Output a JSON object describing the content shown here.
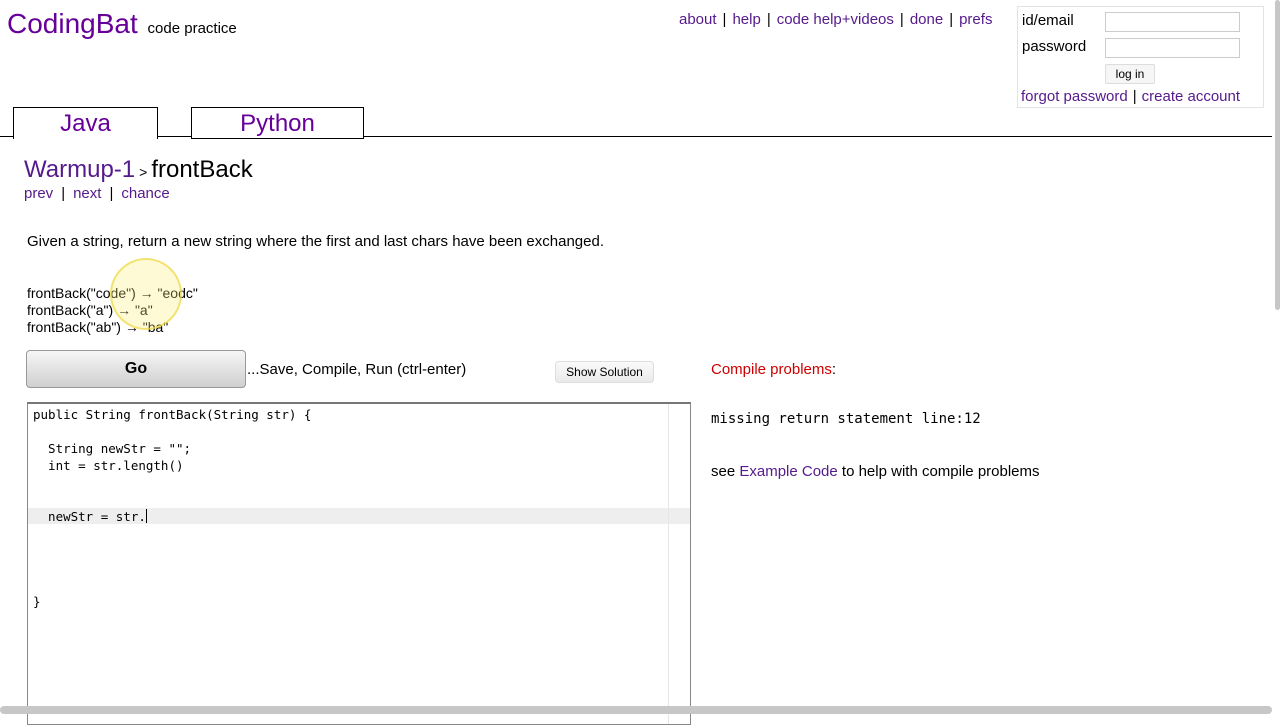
{
  "logo": {
    "title": "CodingBat",
    "subtitle": "code practice"
  },
  "topnav": [
    "about",
    "help",
    "code help+videos",
    "done",
    "prefs"
  ],
  "login": {
    "id_label": "id/email",
    "password_label": "password",
    "login_button": "log in",
    "forgot": "forgot password",
    "create": "create account"
  },
  "tabs": {
    "java": "Java",
    "python": "Python"
  },
  "breadcrumb": {
    "section": "Warmup-1",
    "separator": ">",
    "problem": "frontBack"
  },
  "problem_nav": {
    "prev": "prev",
    "next": "next",
    "chance": "chance"
  },
  "description": "Given a string, return a new string where the first and last chars have been exchanged.",
  "examples": [
    "frontBack(\"code\") → \"eodc\"",
    "frontBack(\"a\") → \"a\"",
    "frontBack(\"ab\") → \"ba\""
  ],
  "actions": {
    "go": "Go",
    "go_hint": "...Save, Compile, Run (ctrl-enter)",
    "show_solution": "Show Solution"
  },
  "editor_lines": [
    "public String frontBack(String str) {",
    "",
    "  String newStr = \"\";",
    "  int = str.length()",
    "",
    "",
    "  newStr = str.",
    "",
    "",
    "",
    "",
    "}"
  ],
  "compile": {
    "title": "Compile problems",
    "colon": ":",
    "message": "missing return statement line:12",
    "see_pre": "see ",
    "see_link": "Example Code",
    "see_post": " to help with compile problems"
  }
}
